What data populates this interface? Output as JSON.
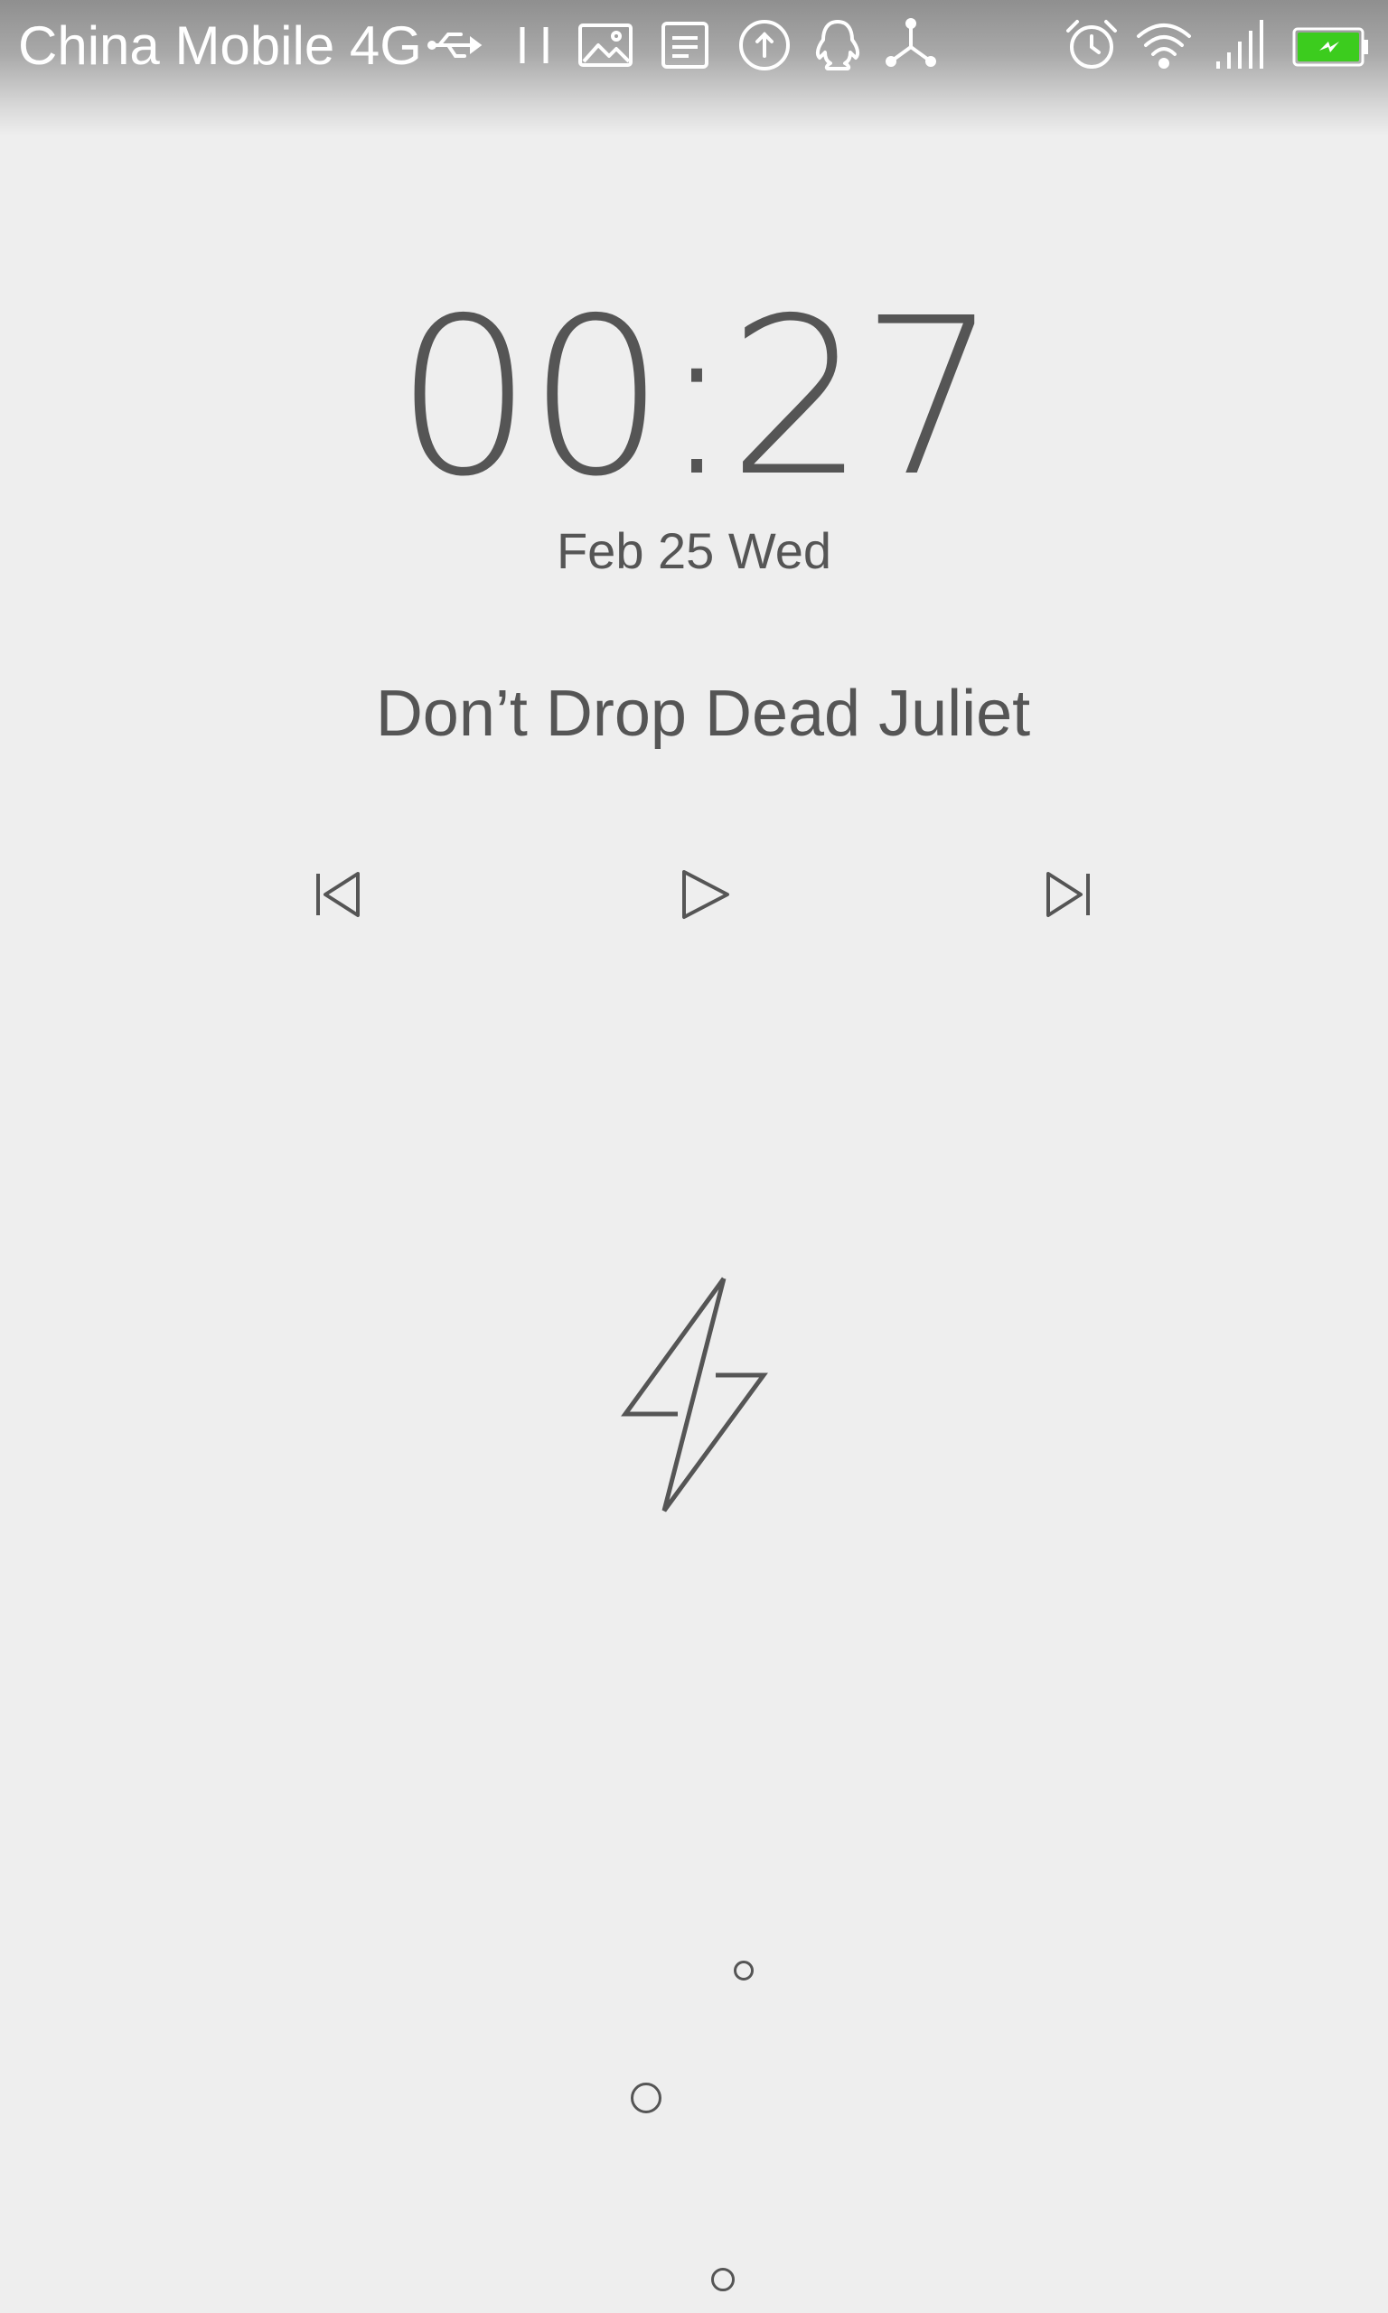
{
  "status_bar": {
    "carrier": "China Mobile 4G",
    "icons": [
      "usb-icon",
      "pause-icon",
      "image-icon",
      "notes-icon",
      "upload-icon",
      "qq-icon",
      "share-icon",
      "alarm-icon",
      "wifi-icon",
      "signal-icon",
      "battery-charging-icon"
    ],
    "battery_color": "#3ccc1e"
  },
  "lockscreen": {
    "time": "00:27",
    "date": "Feb 25 Wed"
  },
  "music": {
    "title": "Don’t Drop Dead Juliet",
    "controls": [
      "previous-icon",
      "play-icon",
      "next-icon"
    ]
  },
  "charging": {
    "icon": "lightning-bolt-icon"
  },
  "unlock": {
    "dots": [
      "small-dot",
      "medium-dot",
      "small-dot"
    ]
  },
  "colors": {
    "background": "#eeeeee",
    "text": "#555555",
    "status_text": "#ffffff"
  }
}
